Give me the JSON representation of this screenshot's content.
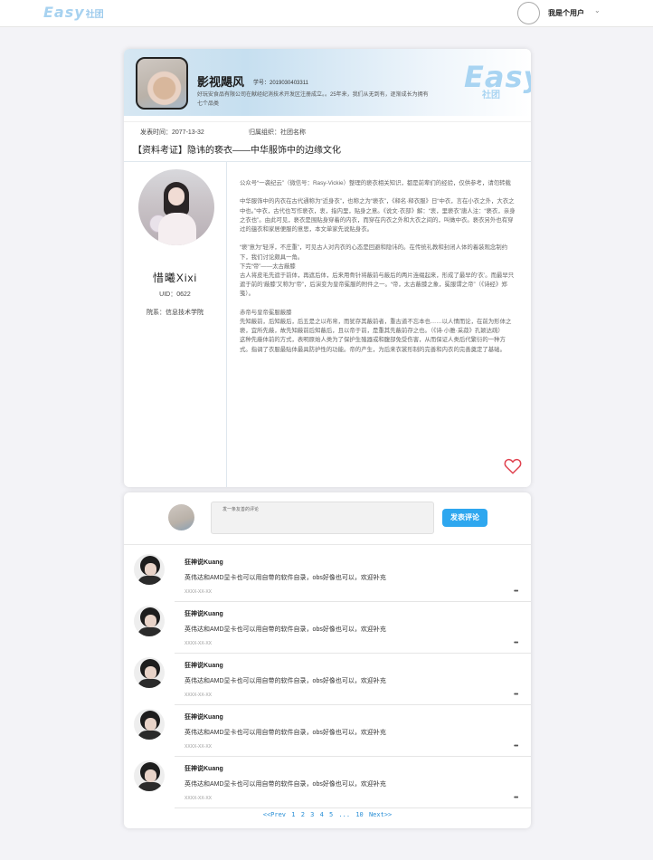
{
  "topbar": {
    "logo_text": "Easy",
    "logo_cn": "社团",
    "user_name": "我是个用户",
    "chevron": "⌄"
  },
  "article": {
    "club_name": "影视飓风",
    "student_id": "学号：2019030403311",
    "club_desc": "好玩安食品有限公司在献经纪消技术开发区注册成立。。25年来，我们从无到有，逐渐成长为拥有七个品类",
    "banner_logo": "Easy",
    "banner_logo_cn": "社团",
    "publish_time": "发表时间：2077-13-32",
    "belongs_to": "归属组织：社团名称",
    "title": "【资料考证】隐讳的亵衣——中华服饰中的边缘文化",
    "author": {
      "name": "惜曦Xixi",
      "uid": "UID：0622",
      "department": "院系：信息技术学院"
    },
    "paragraphs": [
      "公众号“一袭纪云”（微信号：Rasy-Vickie）整理的亵衣相关知识，都是前辈们的经验，仅供参考，请勿转载",
      "中华服饰中的内衣在古代通称为“近身衣”，也称之为“亵衣”，《释名·释衣服》日“中衣，言在小衣之外，大衣之中也。”中衣，古代也写作亵衣，衷，指内里，贴身之意。《说文·衣部》解：“衷，里亵衣”唐人注：“亵衣，亲身之衣也”。由此可见，亵衣是围贴身穿着的内衣，而穿在内衣之外和大衣之间的，叫做中衣。亵衣另外也有穿过的蕴衣和家居便服的意思，本文单家先说贴身衣。",
      "“亵”意为“轻浮，不庄重”，可见古人对内衣的心态是回避和隐讳的。在传统礼教和封闭人体的着装观念制约下，我们讨论颇具一角。",
      "下完“帝”——太古蔽膝",
      "古人将皮毛先遮于前体，再遮后体，后来用骨针将蔽前与蔽后的两片连缀起来，形成了最早的‘衣’。而最早只遮于前的‘蔽膝’又称为“帝”，后演变为皇帝冕服的附件之一。“帝，太古蔽膝之象，冕服谓之帝”（《诗经》郑笺）。",
      "赤帝与皇帝冕服蔽膝",
      "先知蔽前，后知蔽后，后五是之以布帛，而犹存其蔽前者，重古道不忘本也……以人情而论，在前为形体之亵，宜所先蔽，故先知蔽前后知蔽后，且以帝于前，是重其先蔽前存之也。（《诗·小雅·采菽》孔颖达疏）",
      "这种先蔽体前的方式，表明原始人类为了保护生殖器或和腹部免受伤害，从而保证人类后代繁衍的一种方式。指调了衣服最贴体最具防护性的功能。帝的产生，为后来衣裳形制的完善和内衣的完善奠定了基础。"
    ]
  },
  "comments": {
    "placeholder": "发一条友善的评论",
    "submit_label": "发表评论",
    "items": [
      {
        "author": "狂神说Kuang",
        "text": "英伟达和AMD显卡也可以用自带的软件自录，obs好像也可以，欢迎补充",
        "date": "XXXX-XX-XX",
        "more": "•••"
      },
      {
        "author": "狂神说Kuang",
        "text": "英伟达和AMD显卡也可以用自带的软件自录，obs好像也可以，欢迎补充",
        "date": "XXXX-XX-XX",
        "more": "•••"
      },
      {
        "author": "狂神说Kuang",
        "text": "英伟达和AMD显卡也可以用自带的软件自录，obs好像也可以，欢迎补充",
        "date": "XXXX-XX-XX",
        "more": "•••"
      },
      {
        "author": "狂神说Kuang",
        "text": "英伟达和AMD显卡也可以用自带的软件自录，obs好像也可以，欢迎补充",
        "date": "XXXX-XX-XX",
        "more": "•••"
      },
      {
        "author": "狂神说Kuang",
        "text": "英伟达和AMD显卡也可以用自带的软件自录，obs好像也可以，欢迎补充",
        "date": "XXXX-XX-XX",
        "more": "•••"
      }
    ]
  },
  "pagination": {
    "prev": "<<Prev",
    "pages": [
      "1",
      "2",
      "3",
      "4",
      "5"
    ],
    "ellipsis": "...",
    "last": "10",
    "next": "Next>>"
  },
  "colors": {
    "accent": "#2ea7ef",
    "heart": "#e0424f",
    "logo": "#a8d4f2"
  }
}
